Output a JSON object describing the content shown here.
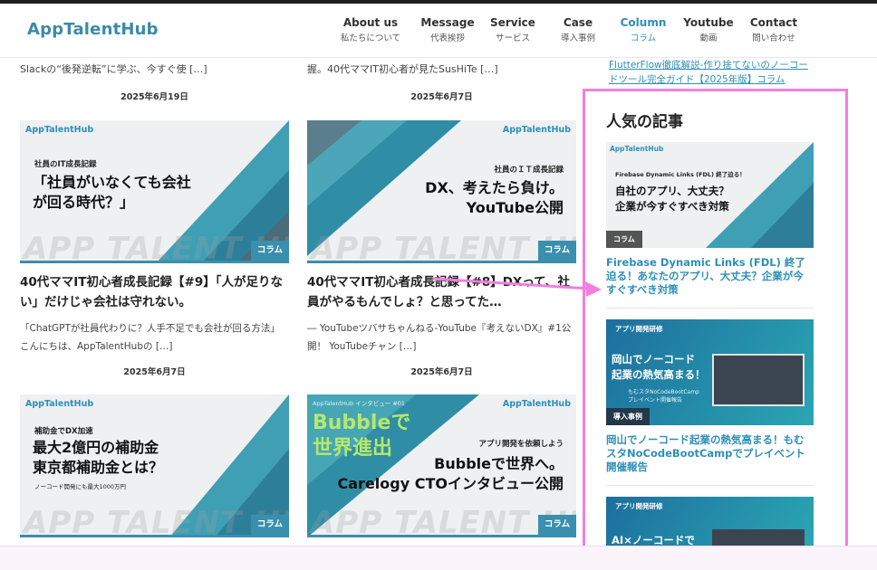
{
  "header": {
    "logo": "AppTalentHub",
    "nav": [
      {
        "en": "About us",
        "jp": "私たちについて",
        "active": false
      },
      {
        "en": "Message",
        "jp": "代表挨拶",
        "active": false
      },
      {
        "en": "Service",
        "jp": "サービス",
        "active": false
      },
      {
        "en": "Case",
        "jp": "導入事例",
        "active": false
      },
      {
        "en": "Column",
        "jp": "コラム",
        "active": true
      },
      {
        "en": "Youtube",
        "jp": "動画",
        "active": false
      },
      {
        "en": "Contact",
        "jp": "問い合わせ",
        "active": false
      }
    ]
  },
  "cutoff": {
    "left": "Slackの“後発逆転”に学ぶ、今すぐ使 […]",
    "right": "握。40代ママIT初心者が見たSusHiTe […]"
  },
  "posts": [
    {
      "date": "2025年6月19日",
      "brand": "AppTalentHub",
      "kicker": "社員のIT成長記録",
      "headline": "「社員がいなくても会社\nが回る時代？」",
      "watermark": "APP TALENT HUB",
      "tag": "コラム",
      "title": "40代ママIT初心者成長記録【#9】「人が足りない」だけじゃ会社は守れない。",
      "excerpt": "「ChatGPTが社員代わりに？人手不足でも会社が回る方法」 こんにちは、AppTalentHubの […]"
    },
    {
      "date": "2025年6月7日",
      "brand": "AppTalentHub",
      "kicker": "社員のＩＴ成長記録",
      "headline": "DX、考えたら負け。\nYouTube公開",
      "watermark": "APP TALENT HUB",
      "tag": "コラム",
      "title": "40代ママIT初心者成長記録【#8】DXって、社員がやるもんでしょ？と思ってた…",
      "excerpt": "― YouTubeツバサちゃんねる-YouTube『考えないDX』#1公開！ YouTubeチャン […]"
    },
    {
      "date": "2025年6月7日",
      "brand": "AppTalentHub",
      "kicker": "補助金でDX加速",
      "headline": "最大2億円の補助金\n東京都補助金とは？",
      "sub": "ノーコード開発にも最大1000万円",
      "watermark": "APP TALENT HUB",
      "tag": "コラム"
    },
    {
      "date": "2025年6月7日",
      "brand": "AppTalentHub",
      "kicker": "アプリ開発を依頼しよう",
      "headline": "Bubbleで世界へ。\nCarelogy CTOインタビュー公開",
      "overlay": "Bubbleで\n世界進出",
      "interview": "AppTalentHub インタビュー #01",
      "watermark": "APP TALENT HUB",
      "tag": "コラム"
    }
  ],
  "sidebar": {
    "top_link": "FlutterFlow徹底解説-作り捨てないのノーコードツール完全ガイド【2025年版】コラム",
    "popular_heading": "人気の記事",
    "popular": [
      {
        "brand": "AppTalentHub",
        "kicker": "Firebase Dynamic Links (FDL) 終了迫る！",
        "headline": "自社のアプリ、大丈夫？\n企業が今すぐすべき対策",
        "tag": "コラム",
        "title": "Firebase Dynamic Links (FDL) 終了迫る！あなたのアプリ、大丈夫？企業が今すぐすべき対策"
      },
      {
        "kicker": "アプリ開発研修",
        "headline": "岡山でノーコード\n起業の熱気高まる！",
        "sub": "もむスタNoCodeBootCamp\nプレイベント開催報告",
        "tag": "導入事例",
        "title": "岡山でノーコード起業の熱気高まる！もむスタNoCodeBootCampでプレイベント開催報告"
      },
      {
        "kicker": "アプリ開発研修",
        "headline": "AI×ノーコードで"
      }
    ]
  },
  "colors": {
    "accent": "#2d8fb8",
    "teal": "#3a8fae",
    "highlight": "#f27ee0"
  }
}
